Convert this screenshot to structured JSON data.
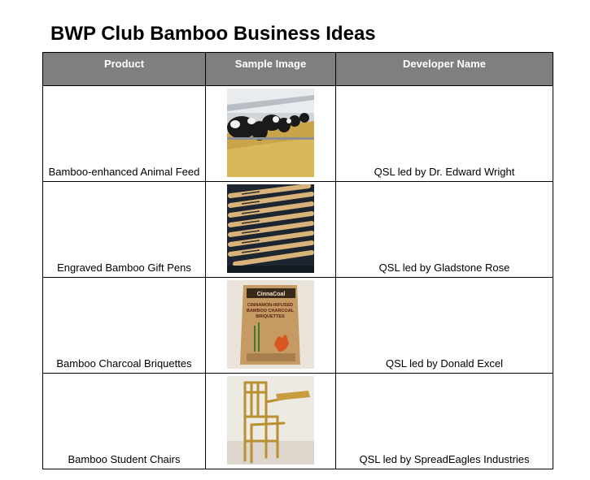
{
  "title": "BWP Club Bamboo Business Ideas",
  "table": {
    "headers": [
      "Product",
      "Sample Image",
      "Developer Name"
    ],
    "rows": [
      {
        "product": "Bamboo-enhanced Animal Feed",
        "image": "cows-feeding-photo",
        "developer": "QSL led by Dr. Edward Wright"
      },
      {
        "product": "Engraved Bamboo Gift Pens",
        "image": "bamboo-pens-photo",
        "developer": "QSL led by Gladstone Rose"
      },
      {
        "product": "Bamboo Charcoal Briquettes",
        "image": "briquettes-bag-photo",
        "developer": "QSL led by Donald Excel",
        "bag_brand": "CinnaCoal",
        "bag_lines": [
          "CINNAMON-INFUSED",
          "BAMBOO CHARCOAL",
          "BRIQUETTES"
        ]
      },
      {
        "product": "Bamboo Student Chairs",
        "image": "bamboo-chair-photo",
        "developer": "QSL led by SpreadEagles Industries"
      }
    ]
  }
}
